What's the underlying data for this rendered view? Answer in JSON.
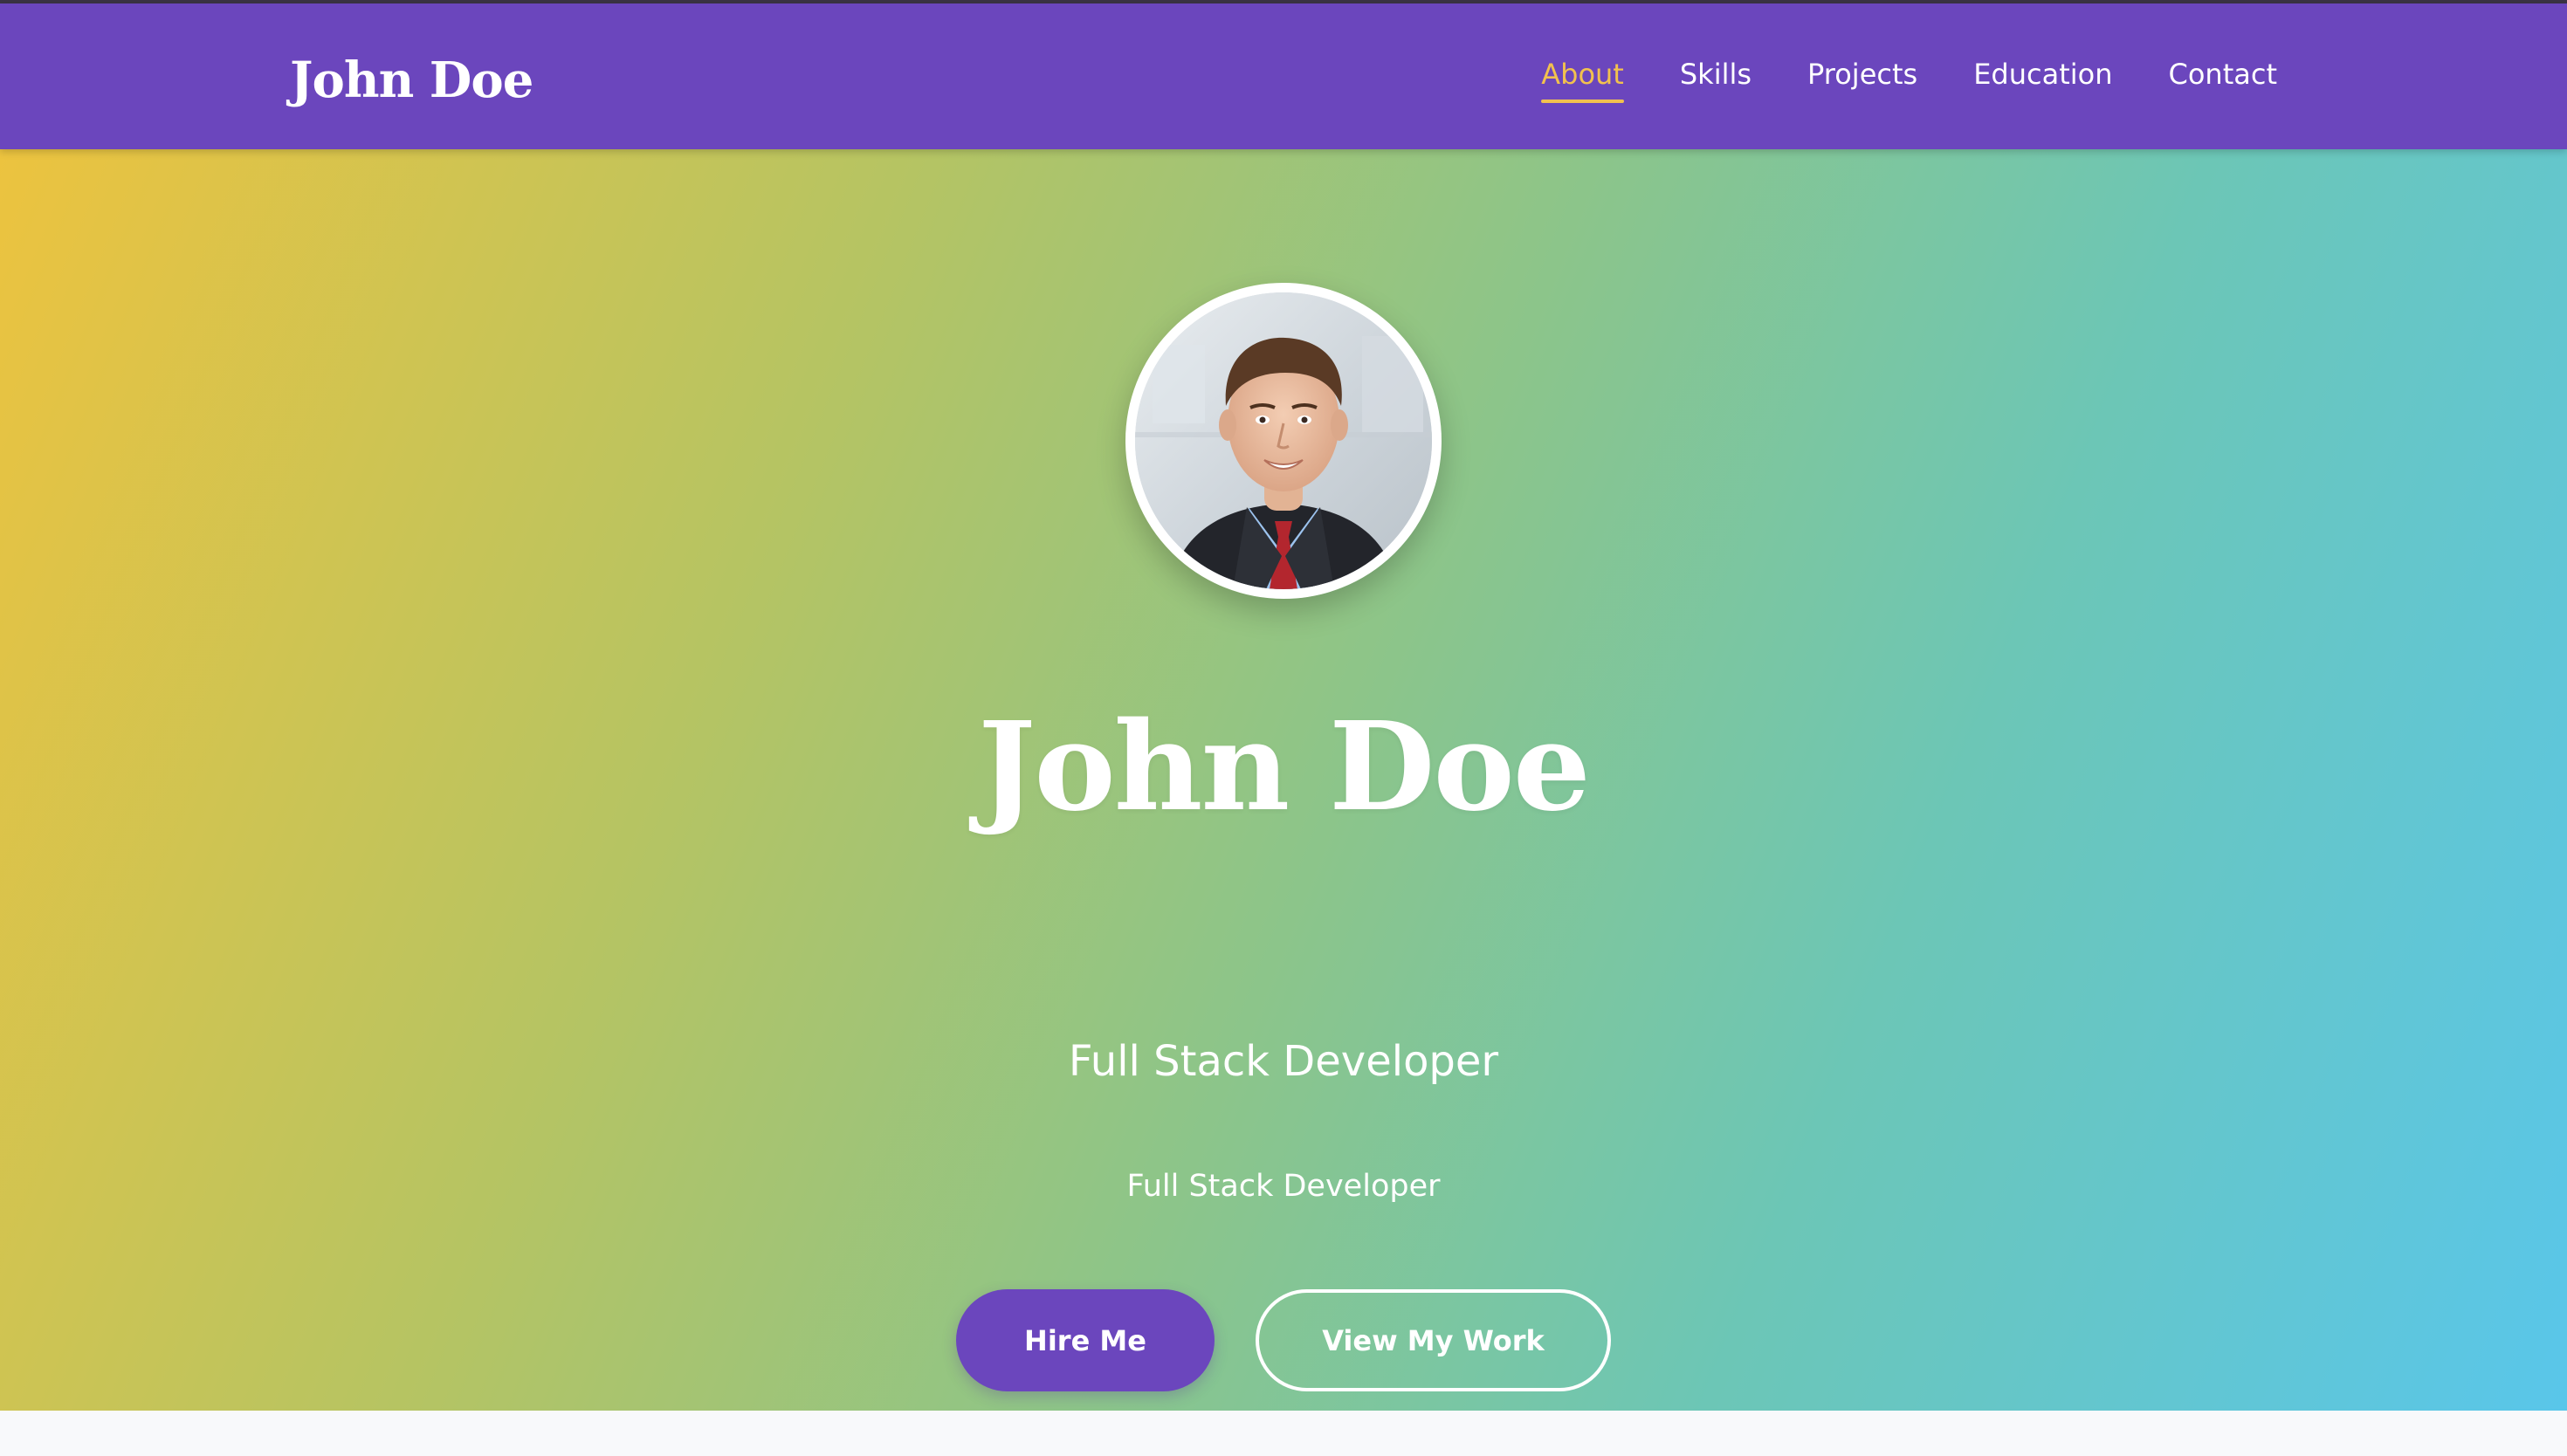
{
  "brand": {
    "name": "John Doe"
  },
  "nav": {
    "items": [
      {
        "label": "About",
        "active": true
      },
      {
        "label": "Skills",
        "active": false
      },
      {
        "label": "Projects",
        "active": false
      },
      {
        "label": "Education",
        "active": false
      },
      {
        "label": "Contact",
        "active": false
      }
    ]
  },
  "hero": {
    "name": "John Doe",
    "title": "Full Stack Developer",
    "subtitle": "Full Stack Developer",
    "buttons": {
      "primary": "Hire Me",
      "secondary": "View My Work"
    }
  },
  "colors": {
    "nav_background": "#6b46bd",
    "active_link": "#f2c14e",
    "gradient_start": "#ecc33f",
    "gradient_end": "#59c6ea",
    "button_primary": "#6b46bd"
  },
  "icons": {
    "avatar": "profile-photo"
  }
}
